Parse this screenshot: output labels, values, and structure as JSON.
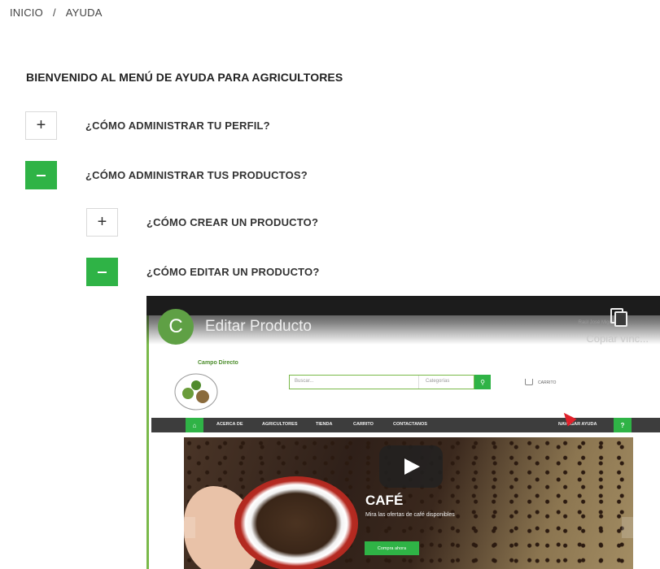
{
  "breadcrumb": {
    "home": "INICIO",
    "separator": "/",
    "current": "AYUDA"
  },
  "welcome": "BIENVENIDO AL MENÚ DE AYUDA PARA AGRICULTORES",
  "accordion": {
    "items": [
      {
        "label": "¿CÓMO ADMINISTRAR TU PERFIL?",
        "icon": "plus-icon",
        "expanded": false
      },
      {
        "label": "¿CÓMO ADMINISTRAR TUS PRODUCTOS?",
        "icon": "minus-icon",
        "expanded": true
      },
      {
        "label": "¿CÓMO CREAR UN PRODUCTO?",
        "icon": "plus-icon",
        "expanded": false
      },
      {
        "label": "¿CÓMO EDITAR UN PRODUCTO?",
        "icon": "minus-icon",
        "expanded": true
      }
    ],
    "plus_symbol": "+"
  },
  "video": {
    "channel_initial": "C",
    "title": "Editar Producto",
    "copy_link": "Copiar vínc...",
    "author": "Raúl José Miguel Ne...",
    "site": {
      "logo_text": "Campo Directo",
      "search_placeholder": "Buscar...",
      "category_select": "Categorías",
      "cart_label": "CARRITO",
      "nav": [
        "ACERCA DE",
        "AGRICULTORES",
        "TIENDA",
        "CARRITO",
        "CONTACTANOS"
      ],
      "nav_help": "NAVEGAR AYUDA",
      "nav_help_icon": "?",
      "banner_title": "CAFÉ",
      "banner_subtitle": "Mira las ofertas de café disponibles",
      "banner_button": "Compra ahora"
    }
  },
  "colors": {
    "accent_green": "#2fb346",
    "nav_dark": "#3d3d3d"
  }
}
